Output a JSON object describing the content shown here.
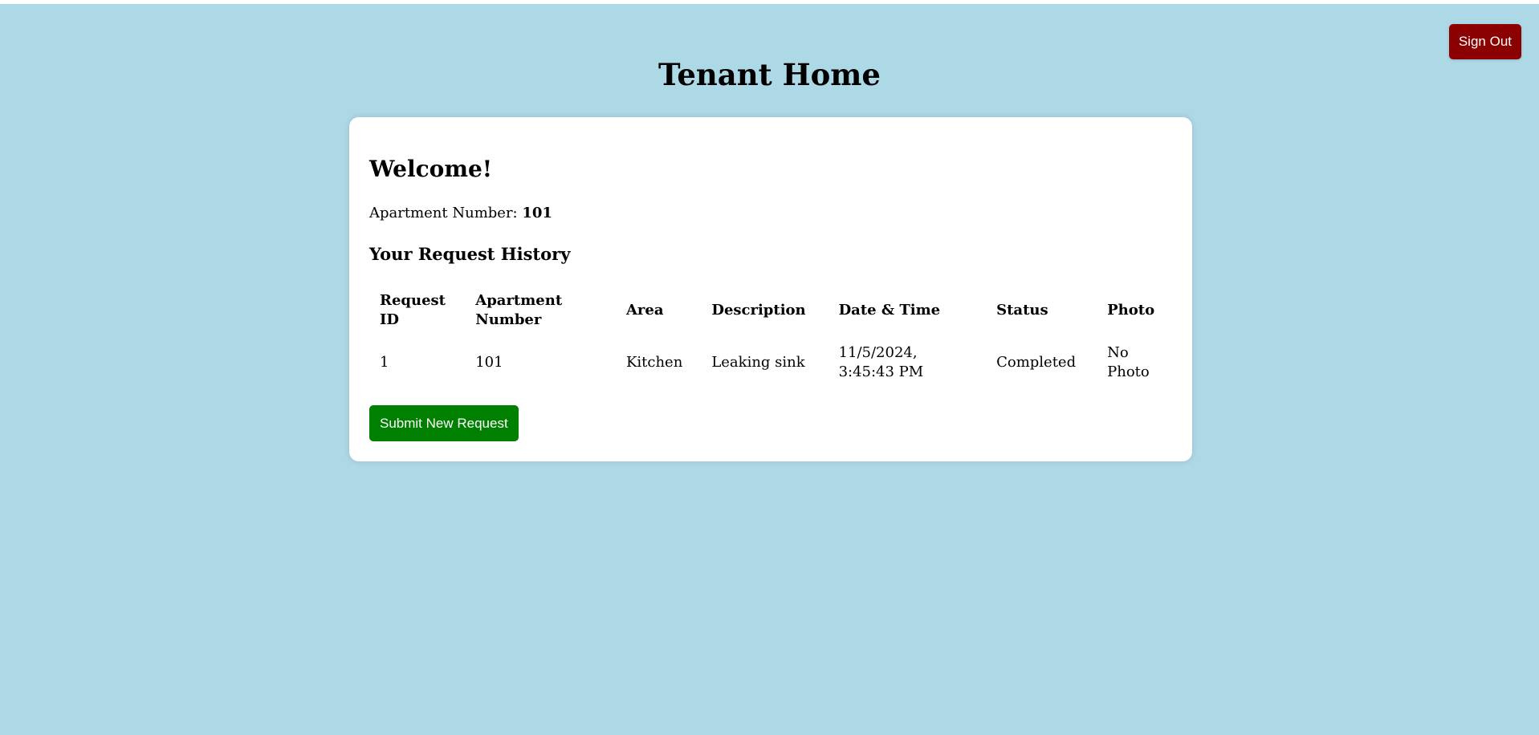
{
  "header": {
    "title": "Tenant Home",
    "sign_out_label": "Sign Out"
  },
  "card": {
    "welcome": "Welcome!",
    "apartment_label": "Apartment Number:",
    "apartment_value": "101",
    "history_title": "Your Request History",
    "submit_label": "Submit New Request"
  },
  "table": {
    "columns": [
      "Request ID",
      "Apartment Number",
      "Area",
      "Description",
      "Date & Time",
      "Status",
      "Photo"
    ],
    "rows": [
      {
        "request_id": "1",
        "apartment_number": "101",
        "area": "Kitchen",
        "description": "Leaking sink",
        "date_time": "11/5/2024, 3:45:43 PM",
        "status": "Completed",
        "photo": "No Photo"
      }
    ]
  },
  "colors": {
    "background": "#add8e6",
    "sign_out": "#8b0000",
    "submit": "#008000",
    "card": "#ffffff"
  }
}
